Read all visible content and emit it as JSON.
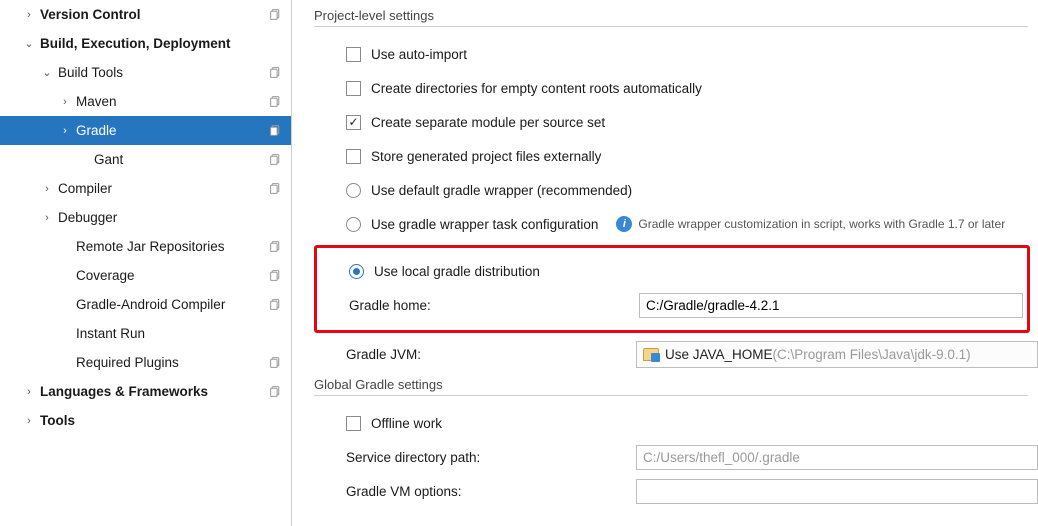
{
  "sidebar": {
    "items": [
      {
        "label": "Version Control",
        "bold": true,
        "chev": "right",
        "indent": 0,
        "copy": true
      },
      {
        "label": "Build, Execution, Deployment",
        "bold": true,
        "chev": "down",
        "indent": 0
      },
      {
        "label": "Build Tools",
        "chev": "down",
        "indent": 1,
        "copy": true
      },
      {
        "label": "Maven",
        "chev": "right",
        "indent": 2,
        "copy": true
      },
      {
        "label": "Gradle",
        "chev": "right",
        "indent": 2,
        "copy": true,
        "selected": true
      },
      {
        "label": "Gant",
        "indent": 3,
        "copy": true
      },
      {
        "label": "Compiler",
        "chev": "right",
        "indent": 1,
        "copy": true
      },
      {
        "label": "Debugger",
        "chev": "right",
        "indent": 1
      },
      {
        "label": "Remote Jar Repositories",
        "indent": 2,
        "copy": true
      },
      {
        "label": "Coverage",
        "indent": 2,
        "copy": true
      },
      {
        "label": "Gradle-Android Compiler",
        "indent": 2,
        "copy": true
      },
      {
        "label": "Instant Run",
        "indent": 2
      },
      {
        "label": "Required Plugins",
        "indent": 2,
        "copy": true
      },
      {
        "label": "Languages & Frameworks",
        "bold": true,
        "chev": "right",
        "indent": 0,
        "copy": true
      },
      {
        "label": "Tools",
        "bold": true,
        "chev": "right",
        "indent": 0
      }
    ]
  },
  "content": {
    "section1": "Project-level settings",
    "auto_import": "Use auto-import",
    "create_dirs": "Create directories for empty content roots automatically",
    "create_module": "Create separate module per source set",
    "store_files": "Store generated project files externally",
    "use_default_wrapper": "Use default gradle wrapper (recommended)",
    "use_task_config": "Use gradle wrapper task configuration",
    "info_text": "Gradle wrapper customization in script, works with Gradle 1.7 or later",
    "use_local": "Use local gradle distribution",
    "gradle_home_label": "Gradle home:",
    "gradle_home_value": "C:/Gradle/gradle-4.2.1",
    "gradle_jvm_label": "Gradle JVM:",
    "gradle_jvm_value": "Use JAVA_HOME",
    "gradle_jvm_detail": " (C:\\Program Files\\Java\\jdk-9.0.1)",
    "section2": "Global Gradle settings",
    "offline": "Offline work",
    "service_dir_label": "Service directory path:",
    "service_dir_value": "C:/Users/thefl_000/.gradle",
    "vm_options_label": "Gradle VM options:"
  }
}
